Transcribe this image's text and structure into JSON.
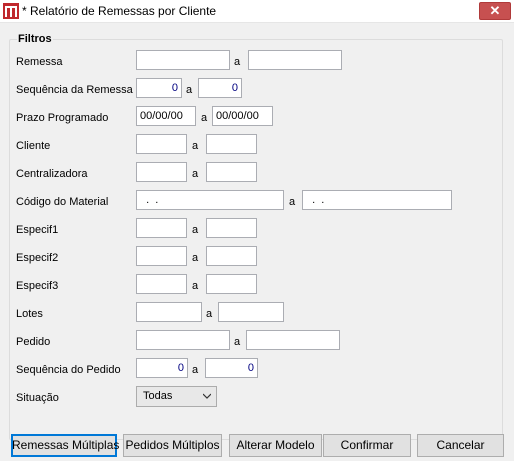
{
  "window": {
    "title": "* Relatório de Remessas por Cliente",
    "close_glyph": "✕"
  },
  "filters": {
    "title": "Filtros",
    "range_separator": "a",
    "remessa": {
      "label": "Remessa",
      "from": "",
      "to": ""
    },
    "sequencia_remessa": {
      "label": "Sequência da Remessa",
      "from": "0",
      "to": "0"
    },
    "prazo_programado": {
      "label": "Prazo Programado",
      "from": "00/00/00",
      "to": "00/00/00"
    },
    "cliente": {
      "label": "Cliente",
      "from": "",
      "to": ""
    },
    "centralizadora": {
      "label": "Centralizadora",
      "from": "",
      "to": ""
    },
    "codigo_material": {
      "label": "Código do Material",
      "from": "  .  .",
      "to": "  .  ."
    },
    "especif1": {
      "label": "Especif1",
      "from": "",
      "to": ""
    },
    "especif2": {
      "label": "Especif2",
      "from": "",
      "to": ""
    },
    "especif3": {
      "label": "Especif3",
      "from": "",
      "to": ""
    },
    "lotes": {
      "label": "Lotes",
      "from": "",
      "to": ""
    },
    "pedido": {
      "label": "Pedido",
      "from": "",
      "to": ""
    },
    "sequencia_pedido": {
      "label": "Sequência do Pedido",
      "from": "0",
      "to": "0"
    },
    "situacao": {
      "label": "Situação",
      "value": "Todas"
    }
  },
  "buttons": {
    "remessas_multiplas": "Remessas Múltiplas",
    "pedidos_multiplos": "Pedidos Múltiplos",
    "alterar_modelo": "Alterar Modelo",
    "confirmar": "Confirmar",
    "cancelar": "Cancelar"
  },
  "colors": {
    "accent": "#0078d7",
    "close": "#c75050",
    "numeric_text": "#000080"
  }
}
